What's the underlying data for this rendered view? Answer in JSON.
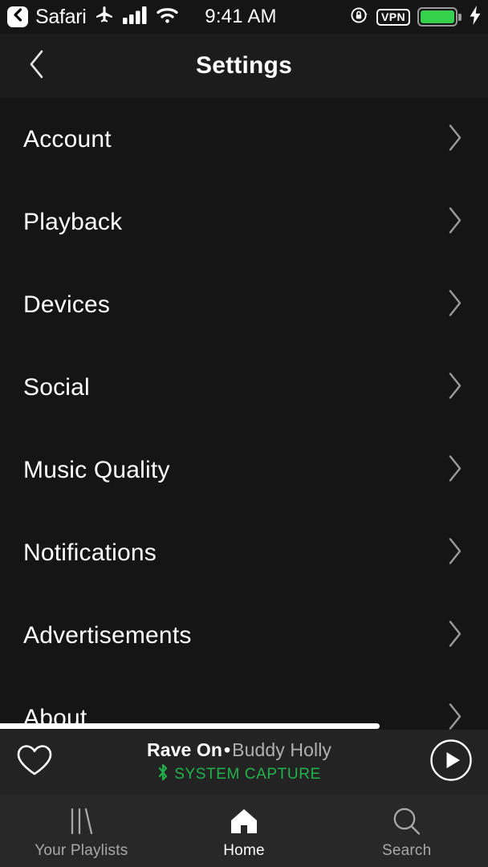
{
  "status_bar": {
    "back_app": "Safari",
    "back_icon": "back-chevron-icon",
    "airplane_icon": "airplane-mode-icon",
    "cellular_icon": "cellular-signal-icon",
    "wifi_icon": "wifi-icon",
    "time": "9:41 AM",
    "rotation_lock_icon": "rotation-lock-icon",
    "vpn_label": "VPN",
    "battery_icon": "battery-icon",
    "charging_icon": "charging-bolt-icon",
    "battery_color": "#36d14d"
  },
  "header": {
    "back_icon": "back-chevron-icon",
    "title": "Settings"
  },
  "settings": {
    "rows": [
      {
        "label": "Account",
        "chevron": "chevron-right-icon"
      },
      {
        "label": "Playback",
        "chevron": "chevron-right-icon"
      },
      {
        "label": "Devices",
        "chevron": "chevron-right-icon"
      },
      {
        "label": "Social",
        "chevron": "chevron-right-icon"
      },
      {
        "label": "Music Quality",
        "chevron": "chevron-right-icon"
      },
      {
        "label": "Notifications",
        "chevron": "chevron-right-icon"
      },
      {
        "label": "Advertisements",
        "chevron": "chevron-right-icon"
      },
      {
        "label": "About",
        "chevron": "chevron-right-icon"
      }
    ]
  },
  "now_playing": {
    "heart_icon": "heart-outline-icon",
    "track": "Rave On",
    "separator": "•",
    "artist": "Buddy Holly",
    "bluetooth_icon": "bluetooth-icon",
    "device": "SYSTEM CAPTURE",
    "device_color": "#22b24c",
    "play_icon": "play-button-icon"
  },
  "tab_bar": {
    "tabs": [
      {
        "label": "Your Playlists",
        "icon": "playlists-icon",
        "active": false
      },
      {
        "label": "Home",
        "icon": "home-icon",
        "active": true
      },
      {
        "label": "Search",
        "icon": "search-icon",
        "active": false
      }
    ]
  }
}
